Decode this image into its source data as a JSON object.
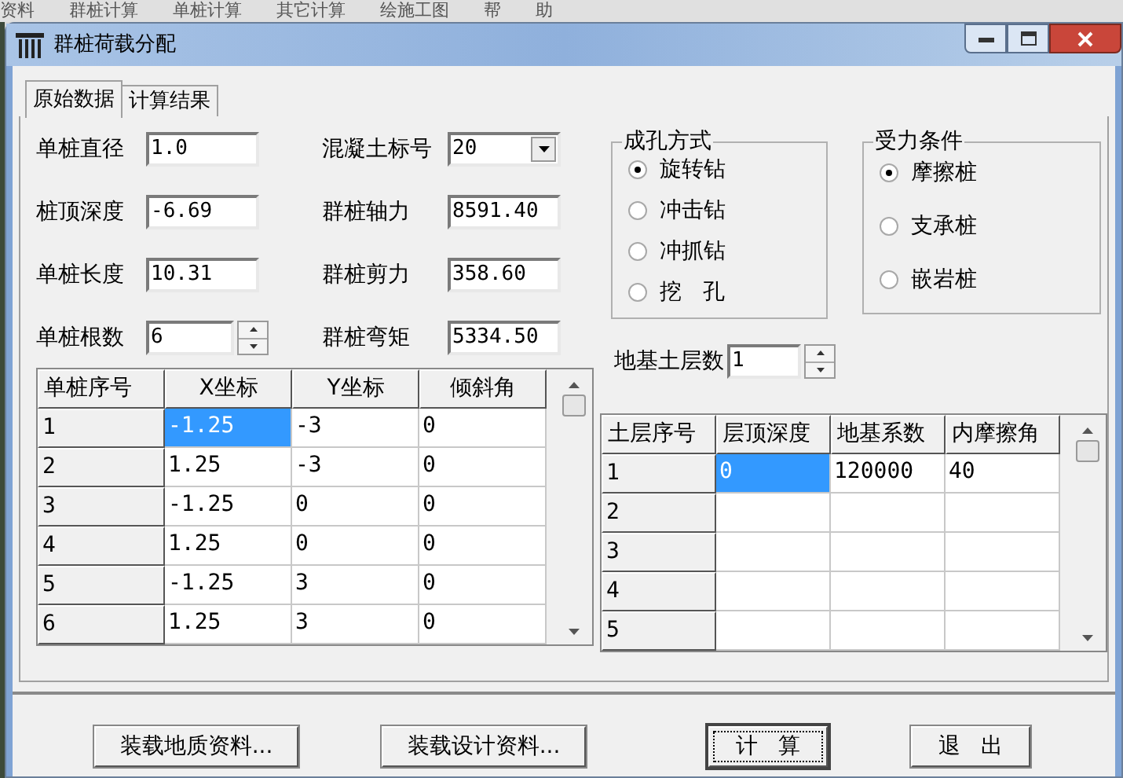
{
  "app_menu": [
    "资料",
    "群桩计算",
    "单桩计算",
    "其它计算",
    "绘施工图",
    "帮",
    "助"
  ],
  "window": {
    "title": "群桩荷载分配"
  },
  "tabs": [
    {
      "label": "原始数据",
      "selected": true
    },
    {
      "label": "计算结果",
      "selected": false
    }
  ],
  "fields": [
    {
      "label": "单桩直径",
      "value": "1.0",
      "kind": "text"
    },
    {
      "label": "混凝土标号",
      "value": "20",
      "kind": "dropdown"
    },
    {
      "label": "桩顶深度",
      "value": "-6.69",
      "kind": "text"
    },
    {
      "label": "群桩轴力",
      "value": "8591.40",
      "kind": "text"
    },
    {
      "label": "单桩长度",
      "value": "10.31",
      "kind": "text"
    },
    {
      "label": "群桩剪力",
      "value": "358.60",
      "kind": "text"
    },
    {
      "label": "单桩根数",
      "value": "6",
      "kind": "spinner"
    },
    {
      "label": "群桩弯矩",
      "value": "5334.50",
      "kind": "text"
    }
  ],
  "hole_method": {
    "title": "成孔方式",
    "options": [
      {
        "label": "旋转钻",
        "selected": true
      },
      {
        "label": "冲击钻",
        "selected": false
      },
      {
        "label": "冲抓钻",
        "selected": false
      },
      {
        "label": "挖   孔",
        "selected": false
      }
    ]
  },
  "load_condition": {
    "title": "受力条件",
    "options": [
      {
        "label": "摩擦桩",
        "selected": true
      },
      {
        "label": "支承桩",
        "selected": false
      },
      {
        "label": "嵌岩桩",
        "selected": false
      }
    ]
  },
  "soil_layers": {
    "label": "地基土层数",
    "value": "1"
  },
  "pile_table": {
    "columns": [
      "单桩序号",
      "X坐标",
      "Y坐标",
      "倾斜角"
    ],
    "rows": [
      {
        "number": "1",
        "cells": [
          {
            "text": "-1.25",
            "selected": true
          },
          {
            "text": "-3",
            "selected": false
          },
          {
            "text": "0",
            "selected": false
          }
        ]
      },
      {
        "number": "2",
        "cells": [
          {
            "text": "1.25",
            "selected": false
          },
          {
            "text": "-3",
            "selected": false
          },
          {
            "text": "0",
            "selected": false
          }
        ]
      },
      {
        "number": "3",
        "cells": [
          {
            "text": "-1.25",
            "selected": false
          },
          {
            "text": "0",
            "selected": false
          },
          {
            "text": "0",
            "selected": false
          }
        ]
      },
      {
        "number": "4",
        "cells": [
          {
            "text": "1.25",
            "selected": false
          },
          {
            "text": "0",
            "selected": false
          },
          {
            "text": "0",
            "selected": false
          }
        ]
      },
      {
        "number": "5",
        "cells": [
          {
            "text": "-1.25",
            "selected": false
          },
          {
            "text": "3",
            "selected": false
          },
          {
            "text": "0",
            "selected": false
          }
        ]
      },
      {
        "number": "6",
        "cells": [
          {
            "text": "1.25",
            "selected": false
          },
          {
            "text": "3",
            "selected": false
          },
          {
            "text": "0",
            "selected": false
          }
        ]
      }
    ]
  },
  "soil_table": {
    "columns": [
      "土层序号",
      "层顶深度",
      "地基系数",
      "内摩擦角"
    ],
    "rows": [
      {
        "number": "1",
        "cells": [
          {
            "text": "0",
            "selected": true
          },
          {
            "text": "120000",
            "selected": false
          },
          {
            "text": "40",
            "selected": false
          }
        ]
      },
      {
        "number": "2"
      },
      {
        "number": "3"
      },
      {
        "number": "4"
      },
      {
        "number": "5"
      }
    ]
  },
  "buttons": [
    {
      "label": "装载地质资料...",
      "focused": false
    },
    {
      "label": "装载设计资料...",
      "focused": false
    },
    {
      "label": "计   算",
      "focused": true
    },
    {
      "label": "退   出",
      "focused": false
    }
  ]
}
